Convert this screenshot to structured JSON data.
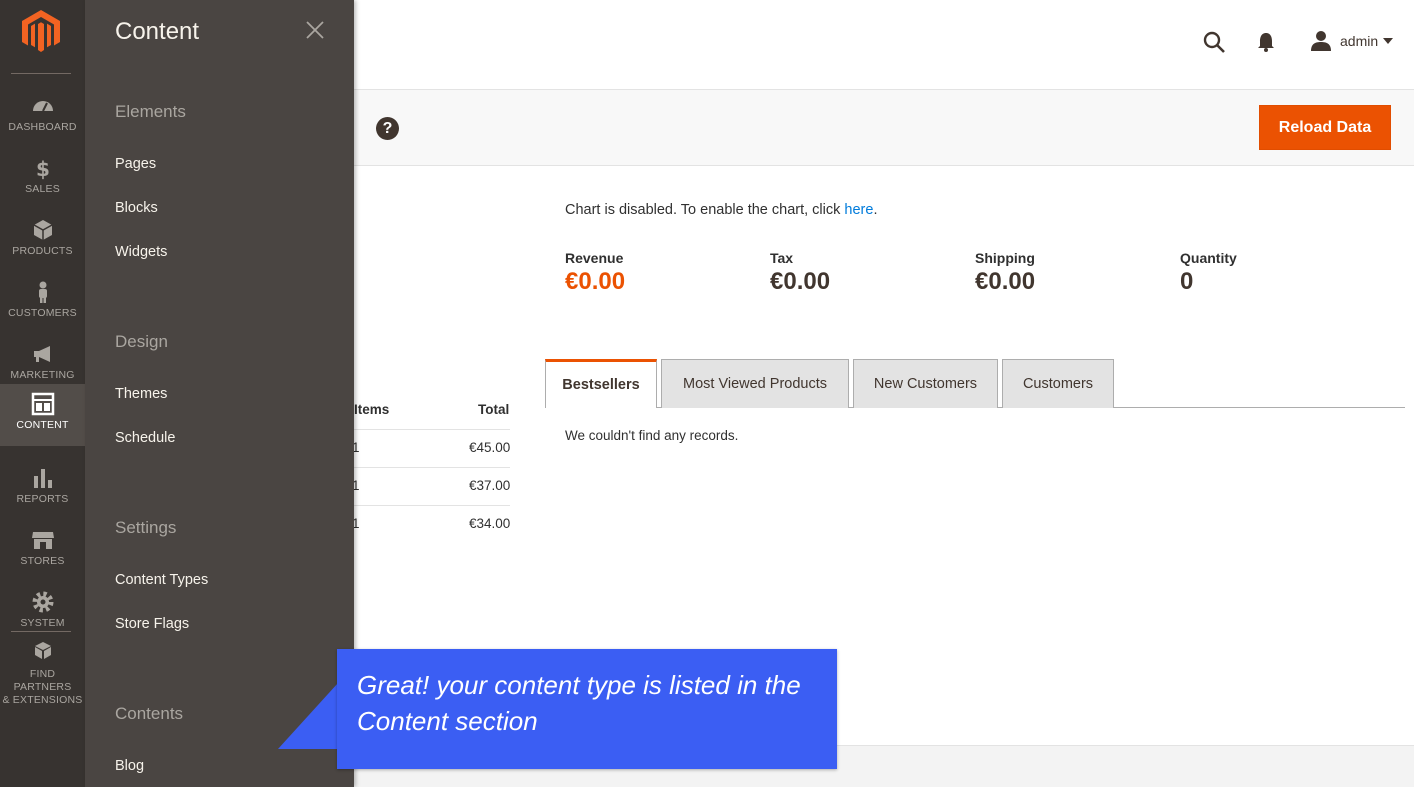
{
  "nav": {
    "logo": "magento-logo",
    "items": [
      {
        "label": "DASHBOARD",
        "icon": "dashboard-icon"
      },
      {
        "label": "SALES",
        "icon": "dollar-icon"
      },
      {
        "label": "PRODUCTS",
        "icon": "cube-icon"
      },
      {
        "label": "CUSTOMERS",
        "icon": "person-icon"
      },
      {
        "label": "MARKETING",
        "icon": "megaphone-icon"
      },
      {
        "label": "CONTENT",
        "icon": "layout-icon"
      },
      {
        "label": "REPORTS",
        "icon": "bar-chart-icon"
      },
      {
        "label": "STORES",
        "icon": "storefront-icon"
      },
      {
        "label": "SYSTEM",
        "icon": "gear-icon"
      },
      {
        "label_line1": "FIND PARTNERS",
        "label_line2": "& EXTENSIONS",
        "icon": "boxes-icon"
      }
    ]
  },
  "panel": {
    "title": "Content",
    "sections": [
      {
        "title": "Elements",
        "links": [
          "Pages",
          "Blocks",
          "Widgets"
        ]
      },
      {
        "title": "Design",
        "links": [
          "Themes",
          "Schedule"
        ]
      },
      {
        "title": "Settings",
        "links": [
          "Content Types",
          "Store Flags"
        ]
      },
      {
        "title": "Contents",
        "links": [
          "Blog"
        ]
      }
    ]
  },
  "header": {
    "user": "admin"
  },
  "actions": {
    "help": "?",
    "reload": "Reload Data"
  },
  "chart": {
    "message": "Chart is disabled. To enable the chart, click ",
    "link": "here",
    "period": "."
  },
  "stats": [
    {
      "label": "Revenue",
      "value": "€0.00"
    },
    {
      "label": "Tax",
      "value": "€0.00"
    },
    {
      "label": "Shipping",
      "value": "€0.00"
    },
    {
      "label": "Quantity",
      "value": "0"
    }
  ],
  "left_table": {
    "headers": {
      "items": "Items",
      "total": "Total"
    },
    "rows": [
      {
        "items": "1",
        "total": "€45.00"
      },
      {
        "items": "1",
        "total": "€37.00"
      },
      {
        "items": "1",
        "total": "€34.00"
      }
    ]
  },
  "tabs": [
    "Bestsellers",
    "Most Viewed Products",
    "New Customers",
    "Customers"
  ],
  "no_records": "We couldn't find any records.",
  "callout": {
    "text": "Great! your content type is listed in the Content section"
  },
  "colors": {
    "accent": "#eb5202",
    "nav_bg": "#373330",
    "panel_bg": "#4a4542",
    "callout": "#3b5ef3",
    "link": "#007bdb"
  }
}
